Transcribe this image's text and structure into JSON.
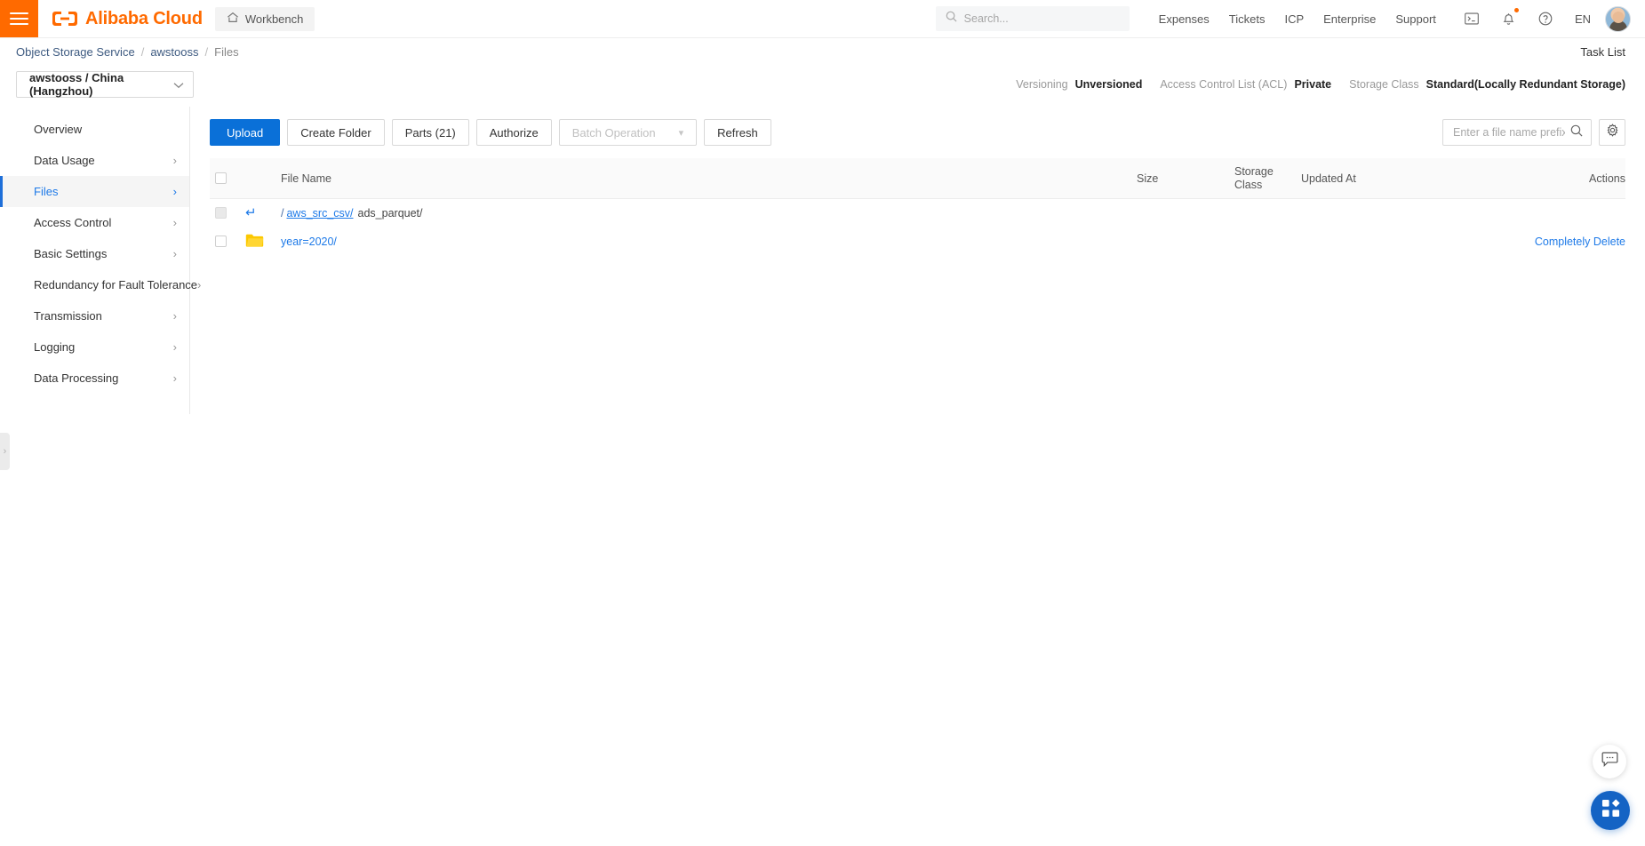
{
  "header": {
    "brand": "Alibaba Cloud",
    "workbench_label": "Workbench",
    "search_placeholder": "Search...",
    "links": [
      "Expenses",
      "Tickets",
      "ICP",
      "Enterprise",
      "Support"
    ],
    "icons": [
      "terminal-icon",
      "bell-icon",
      "help-icon"
    ],
    "language": "EN"
  },
  "breadcrumb": {
    "items": [
      "Object Storage Service",
      "awstooss",
      "Files"
    ],
    "separator": "/",
    "task_list_label": "Task List"
  },
  "bucket": {
    "selector_label": "awstooss / China (Hangzhou)",
    "meta": [
      {
        "label": "Versioning",
        "value": "Unversioned"
      },
      {
        "label": "Access Control List (ACL)",
        "value": "Private"
      },
      {
        "label": "Storage Class",
        "value": "Standard(Locally Redundant Storage)"
      }
    ]
  },
  "sidebar": {
    "items": [
      {
        "label": "Overview",
        "has_chevron": false,
        "active": false
      },
      {
        "label": "Data Usage",
        "has_chevron": true,
        "active": false
      },
      {
        "label": "Files",
        "has_chevron": true,
        "active": true
      },
      {
        "label": "Access Control",
        "has_chevron": true,
        "active": false
      },
      {
        "label": "Basic Settings",
        "has_chevron": true,
        "active": false
      },
      {
        "label": "Redundancy for Fault Tolerance",
        "has_chevron": true,
        "active": false
      },
      {
        "label": "Transmission",
        "has_chevron": true,
        "active": false
      },
      {
        "label": "Logging",
        "has_chevron": true,
        "active": false
      },
      {
        "label": "Data Processing",
        "has_chevron": true,
        "active": false
      }
    ]
  },
  "toolbar": {
    "upload_label": "Upload",
    "create_folder_label": "Create Folder",
    "parts_label": "Parts (21)",
    "authorize_label": "Authorize",
    "batch_operation_label": "Batch Operation",
    "refresh_label": "Refresh",
    "search_placeholder": "Enter a file name prefix",
    "search_value": ""
  },
  "table": {
    "columns": {
      "file_name": "File Name",
      "size": "Size",
      "storage_class_line1": "Storage",
      "storage_class_line2": "Class",
      "updated_at": "Updated At",
      "actions": "Actions"
    },
    "path_row": {
      "root": "/",
      "link": "aws_src_csv/",
      "current": "ads_parquet/"
    },
    "rows": [
      {
        "name": "year=2020/",
        "icon": "folder-icon",
        "size": "",
        "storage_class": "",
        "updated_at": "",
        "action": "Completely Delete"
      }
    ]
  },
  "fab": {
    "chat_icon": "chat-icon",
    "apps_icon": "apps-grid-icon"
  },
  "colors": {
    "brand_orange": "#ff6a00",
    "primary_blue": "#0a70d8",
    "link_blue": "#1e7ae8",
    "folder_yellow": "#fcc800"
  }
}
